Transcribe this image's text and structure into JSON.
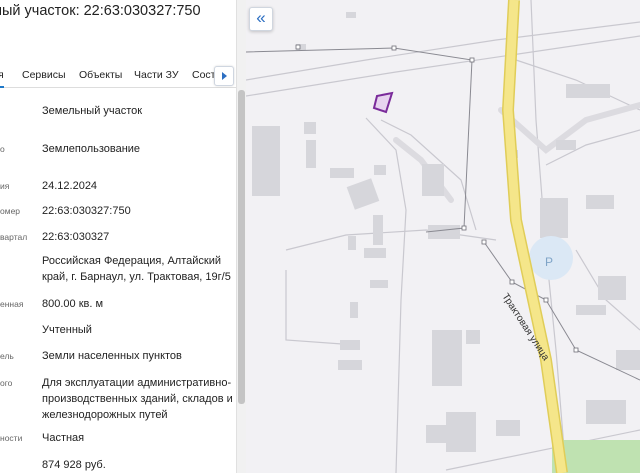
{
  "panel": {
    "title": "ный участок: 22:63:030327:750",
    "tabs": [
      "я",
      "Сервисы",
      "Объекты",
      "Части ЗУ",
      "Соста"
    ],
    "rows": [
      {
        "label": "",
        "value": "Земельный участок"
      },
      {
        "label": "о",
        "value": "Землепользование"
      },
      {
        "label": "ия",
        "value": "24.12.2024"
      },
      {
        "label": "омер",
        "value": "22:63:030327:750"
      },
      {
        "label": "вартал",
        "value": "22:63:030327"
      },
      {
        "label": "",
        "value": "Российская Федерация, Алтайский край, г. Барнаул, ул. Трактовая, 19г/5"
      },
      {
        "label": "енная",
        "value": "800.00 кв. м"
      },
      {
        "label": "",
        "value": "Учтенный"
      },
      {
        "label": "ель",
        "value": "Земли населенных пунктов"
      },
      {
        "label": "ого",
        "value": "Для эксплуатации административно-производственных зданий, складов и железнодорожных путей"
      },
      {
        "label": "ности",
        "value": "Частная"
      },
      {
        "label": "",
        "value": "874 928 руб."
      }
    ]
  },
  "map": {
    "collapse_icon": "«",
    "street_label": "Трактовая улица",
    "parking_label": "P",
    "colors": {
      "background": "#f2f1f4",
      "road_main": "#f5e68a",
      "road_main_border": "#e3cf5a",
      "building": "#d6d6db",
      "parcel_outline": "#7a2b9a",
      "parcel_fill": "#e7d3ef",
      "parking": "#dbe8f5",
      "green": "#bfe2b1"
    }
  }
}
